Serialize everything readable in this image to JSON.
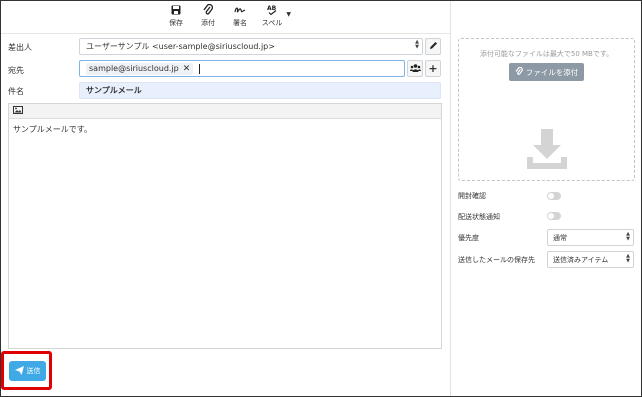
{
  "toolbar": {
    "save": {
      "label": "保存",
      "icon": "floppy-icon"
    },
    "attach": {
      "label": "添付",
      "icon": "paperclip-icon"
    },
    "signature": {
      "label": "署名",
      "icon": "signature-icon"
    },
    "spell": {
      "label": "スペル",
      "icon": "spellcheck-icon"
    }
  },
  "form": {
    "from_label": "差出人",
    "from_value": "ユーザーサンプル <user-sample@siriuscloud.jp>",
    "to_label": "宛先",
    "to_tag": "sample@siriuscloud.jp",
    "subject_label": "件名",
    "subject_value": "サンプルメール"
  },
  "editor": {
    "body": "サンプルメールです。"
  },
  "send": {
    "label": "送信"
  },
  "attachments": {
    "note": "添付可能なファイルは最大で50 MBです。",
    "button": "ファイルを添付"
  },
  "options": {
    "read_receipt": "開封確認",
    "delivery_status": "配送状態通知",
    "priority_label": "優先度",
    "priority_value": "通常",
    "save_sent_label": "送信したメールの保存先",
    "save_sent_value": "送信済みアイテム"
  },
  "colors": {
    "send_button": "#3fa9e6",
    "highlight": "#e00000",
    "subject_bg": "#e8effd"
  }
}
